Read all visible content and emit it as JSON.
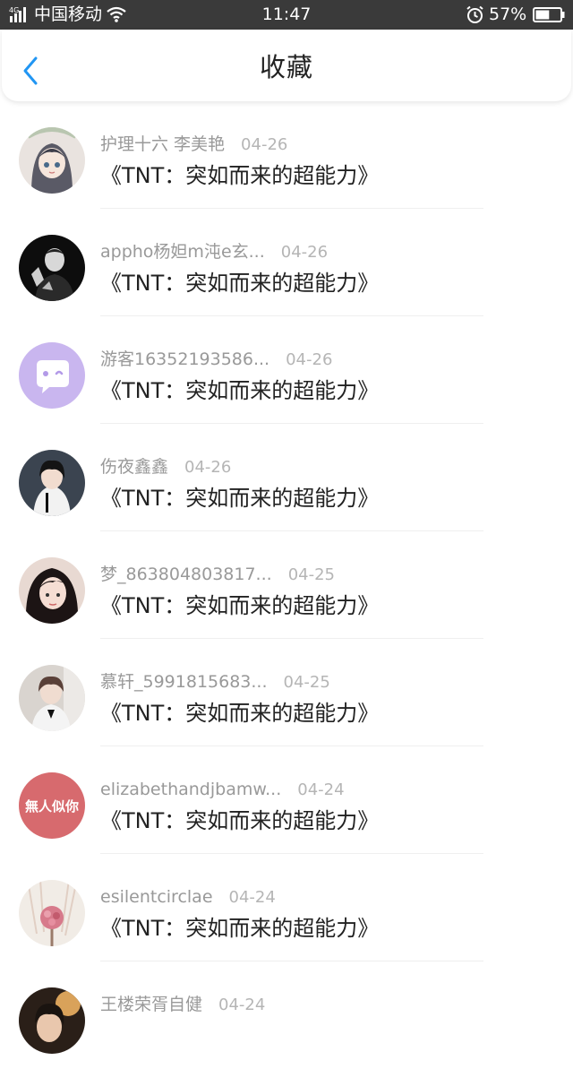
{
  "status_bar": {
    "network": "4G",
    "carrier": "中国移动",
    "time": "11:47",
    "battery_percent": "57%",
    "battery_level": 0.57,
    "icons": [
      "signal-icon",
      "wifi-icon",
      "alarm-icon",
      "battery-icon"
    ]
  },
  "header": {
    "title": "收藏",
    "back_icon": "chevron-left-icon",
    "accent_color": "#2196f3"
  },
  "items": [
    {
      "username": "护理十六 李美艳",
      "date": "04-26",
      "title": "《TNT：突如而来的超能力》"
    },
    {
      "username": "appho杨妲m沌e玄...",
      "date": "04-26",
      "title": "《TNT：突如而来的超能力》"
    },
    {
      "username": "游客16352193586...",
      "date": "04-26",
      "title": "《TNT：突如而来的超能力》"
    },
    {
      "username": "伤夜鑫鑫",
      "date": "04-26",
      "title": "《TNT：突如而来的超能力》"
    },
    {
      "username": "梦_863804803817...",
      "date": "04-25",
      "title": "《TNT：突如而来的超能力》"
    },
    {
      "username": "慕轩_5991815683...",
      "date": "04-25",
      "title": "《TNT：突如而来的超能力》"
    },
    {
      "username": "elizabethandjbamw...",
      "date": "04-24",
      "title": "《TNT：突如而来的超能力》"
    },
    {
      "username": "esilentcirclae",
      "date": "04-24",
      "title": "《TNT：突如而来的超能力》"
    },
    {
      "username": "王楼荣胥自健",
      "date": "04-24",
      "title": ""
    }
  ],
  "avatar_texts": {
    "item7": "無人似你"
  }
}
